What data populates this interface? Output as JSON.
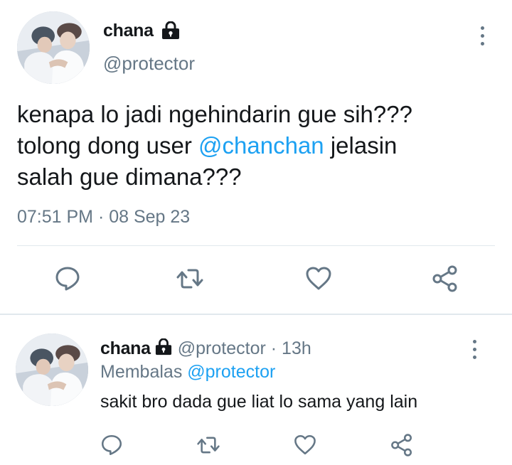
{
  "main_tweet": {
    "user": {
      "name": "chana",
      "handle": "@protector"
    },
    "text_line1": "kenapa lo jadi ngehindarin gue sih???",
    "text_line2_before": "tolong dong user ",
    "text_line2_mention": "@chanchan",
    "text_line2_after": " jelasin",
    "text_line3": "salah gue dimana???",
    "timestamp": "07:51 PM · 08 Sep 23"
  },
  "reply_tweet": {
    "user": {
      "name": "chana",
      "handle": "@protector"
    },
    "time": "· 13h",
    "replying_prefix": "Membalas ",
    "replying_to": "@protector",
    "text": "sakit bro dada gue liat lo sama yang lain"
  },
  "icons": [
    "lock-icon",
    "more-icon",
    "reply-icon",
    "retweet-icon",
    "like-icon",
    "share-icon"
  ],
  "colors": {
    "text": "#14171a",
    "secondary": "#657786",
    "accent": "#1da1f2",
    "divider": "#e1e8ed"
  }
}
